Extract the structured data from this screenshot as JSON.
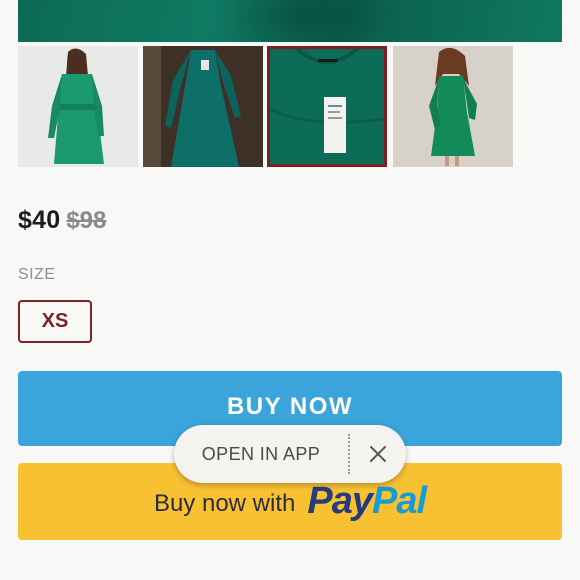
{
  "product": {
    "price": "$40",
    "original_price": "$98",
    "size_label": "SIZE",
    "selected_size": "XS"
  },
  "actions": {
    "buy_now_label": "BUY NOW",
    "paypal_lead": "Buy now with",
    "paypal_logo_pay": "Pay",
    "paypal_logo_pal": "Pal"
  },
  "banner": {
    "open_in_app_label": "OPEN IN APP",
    "close_icon": "close-icon"
  },
  "gallery": {
    "thumbnails": [
      "dress-front-photo",
      "dress-hanger-photo",
      "dress-tag-closeup-photo",
      "dress-model-photo"
    ],
    "selected_index": 2
  },
  "colors": {
    "buy_now_bg": "#3ba4da",
    "paypal_bg": "#f7c132",
    "selected_border": "#7b2228",
    "dress_green": "#0f7a63"
  }
}
